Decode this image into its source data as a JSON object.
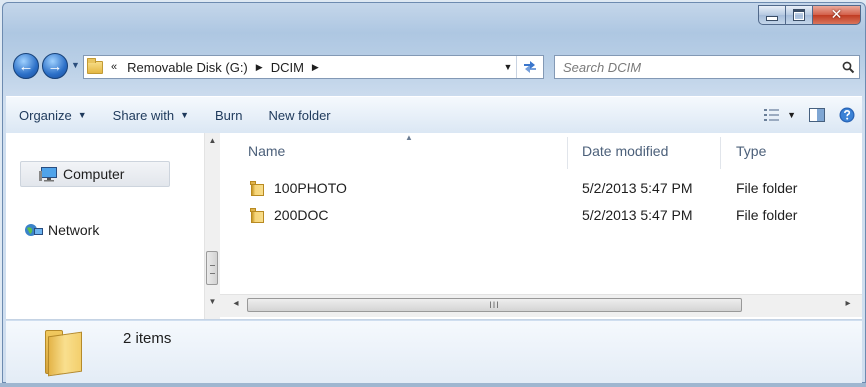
{
  "window": {
    "caption_buttons": [
      "minimize",
      "maximize",
      "close"
    ]
  },
  "navbar": {
    "breadcrumb": {
      "overflow": "«",
      "items": [
        "Removable Disk (G:)",
        "DCIM"
      ]
    },
    "search": {
      "placeholder": "Search DCIM"
    }
  },
  "toolbar": {
    "organize": "Organize",
    "share_with": "Share with",
    "burn": "Burn",
    "new_folder": "New folder"
  },
  "nav_pane": {
    "items": [
      {
        "label": "Computer",
        "icon": "computer-icon",
        "selected": true
      },
      {
        "label": "Network",
        "icon": "network-icon",
        "selected": false
      }
    ]
  },
  "file_list": {
    "columns": [
      "Name",
      "Date modified",
      "Type"
    ],
    "sorted_by": "Name",
    "rows": [
      {
        "name": "100PHOTO",
        "date": "5/2/2013 5:47 PM",
        "type": "File folder"
      },
      {
        "name": "200DOC",
        "date": "5/2/2013 5:47 PM",
        "type": "File folder"
      }
    ],
    "hscroll_grip": "III"
  },
  "details": {
    "count": "2 items"
  },
  "colors": {
    "frame": "#b9cfe6",
    "toolbar_text": "#1e395b",
    "close_button": "#c03b22",
    "folder": "#f6d579"
  }
}
